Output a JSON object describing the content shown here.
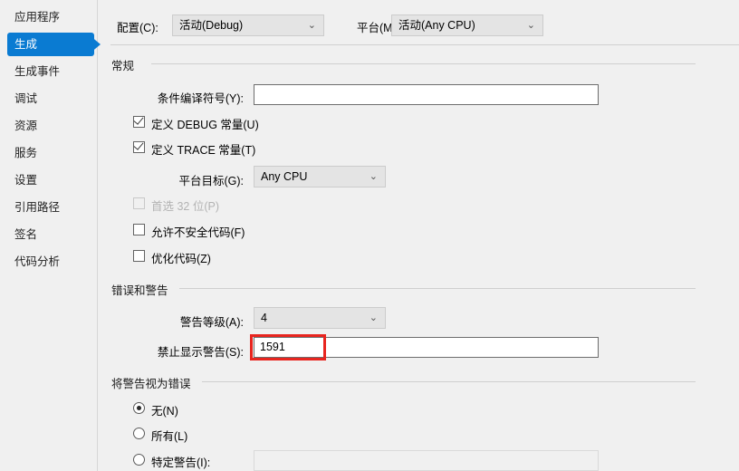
{
  "sidebar": {
    "items": [
      {
        "label": "应用程序",
        "selected": false,
        "name": "sidebar-item-application"
      },
      {
        "label": "生成",
        "selected": true,
        "name": "sidebar-item-build"
      },
      {
        "label": "生成事件",
        "selected": false,
        "name": "sidebar-item-build-events"
      },
      {
        "label": "调试",
        "selected": false,
        "name": "sidebar-item-debug"
      },
      {
        "label": "资源",
        "selected": false,
        "name": "sidebar-item-resources"
      },
      {
        "label": "服务",
        "selected": false,
        "name": "sidebar-item-services"
      },
      {
        "label": "设置",
        "selected": false,
        "name": "sidebar-item-settings"
      },
      {
        "label": "引用路径",
        "selected": false,
        "name": "sidebar-item-reference-paths"
      },
      {
        "label": "签名",
        "selected": false,
        "name": "sidebar-item-signing"
      },
      {
        "label": "代码分析",
        "selected": false,
        "name": "sidebar-item-code-analysis"
      }
    ],
    "selection_color": "#0a7bd2"
  },
  "top": {
    "config_label": "配置(C):",
    "config_value": "活动(Debug)",
    "platform_label": "平台(M):",
    "platform_value": "活动(Any CPU)",
    "chevron": "⌄"
  },
  "general": {
    "header": "常规",
    "conditional_symbols_label": "条件编译符号(Y):",
    "conditional_symbols_value": "",
    "define_debug_label": "定义 DEBUG 常量(U)",
    "define_debug_checked": true,
    "define_trace_label": "定义 TRACE 常量(T)",
    "define_trace_checked": true,
    "platform_target_label": "平台目标(G):",
    "platform_target_value": "Any CPU",
    "prefer32_label": "首选 32 位(P)",
    "prefer32_checked": false,
    "prefer32_disabled": true,
    "unsafe_label": "允许不安全代码(F)",
    "unsafe_checked": false,
    "optimize_label": "优化代码(Z)",
    "optimize_checked": false
  },
  "errors": {
    "header": "错误和警告",
    "warning_level_label": "警告等级(A):",
    "warning_level_value": "4",
    "suppress_warnings_label": "禁止显示警告(S):",
    "suppress_warnings_value": "1591",
    "highlight_color": "#e8251f"
  },
  "warnings_as_errors": {
    "header": "将警告视为错误",
    "none_label": "无(N)",
    "none_selected": true,
    "all_label": "所有(L)",
    "all_selected": false,
    "specific_label": "特定警告(I):",
    "specific_selected": false,
    "specific_value": ""
  }
}
